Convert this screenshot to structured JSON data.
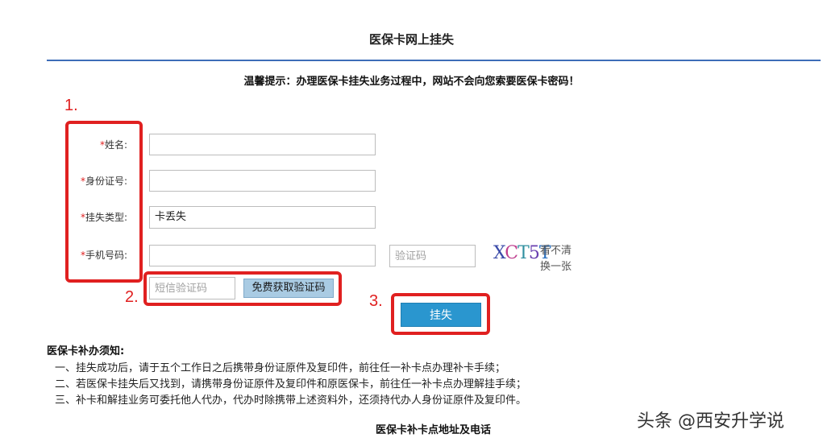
{
  "page": {
    "title": "医保卡网上挂失",
    "tip": "温馨提示：办理医保卡挂失业务过程中，网站不会向您索要医保卡密码！"
  },
  "steps": {
    "one": "1.",
    "two": "2.",
    "three": "3."
  },
  "form": {
    "required_mark": "*",
    "name_label": "姓名:",
    "id_label": "身份证号:",
    "loss_type_label": "挂失类型:",
    "loss_type_value": "卡丢失",
    "phone_label": "手机号码:",
    "captcha_placeholder": "验证码",
    "captcha_text": [
      "X",
      "C",
      "T",
      "5",
      "T"
    ],
    "captcha_refresh_line1": "看不清",
    "captcha_refresh_line2": "换一张",
    "sms_placeholder": "短信验证码",
    "sms_button": "免费获取验证码",
    "submit_button": "挂失"
  },
  "notice": {
    "title": "医保卡补办须知:",
    "lines": [
      "一、挂失成功后，请于五个工作日之后携带身份证原件及复印件，前往任一补卡点办理补卡手续；",
      "二、若医保卡挂失后又找到，请携带身份证原件及复印件和原医保卡，前往任一补卡点办理解挂手续；",
      "三、补卡和解挂业务可委托他人代办，代办时除携带上述资料外，还须持代办人身份证原件及复印件。"
    ],
    "bottom_title": "医保卡补卡点地址及电话"
  },
  "watermark": "头条 @西安升学说",
  "colors": {
    "accent": "#3d6db8",
    "annotation": "#e02020",
    "submit": "#2a96cf",
    "sms": "#a9cbe3"
  }
}
